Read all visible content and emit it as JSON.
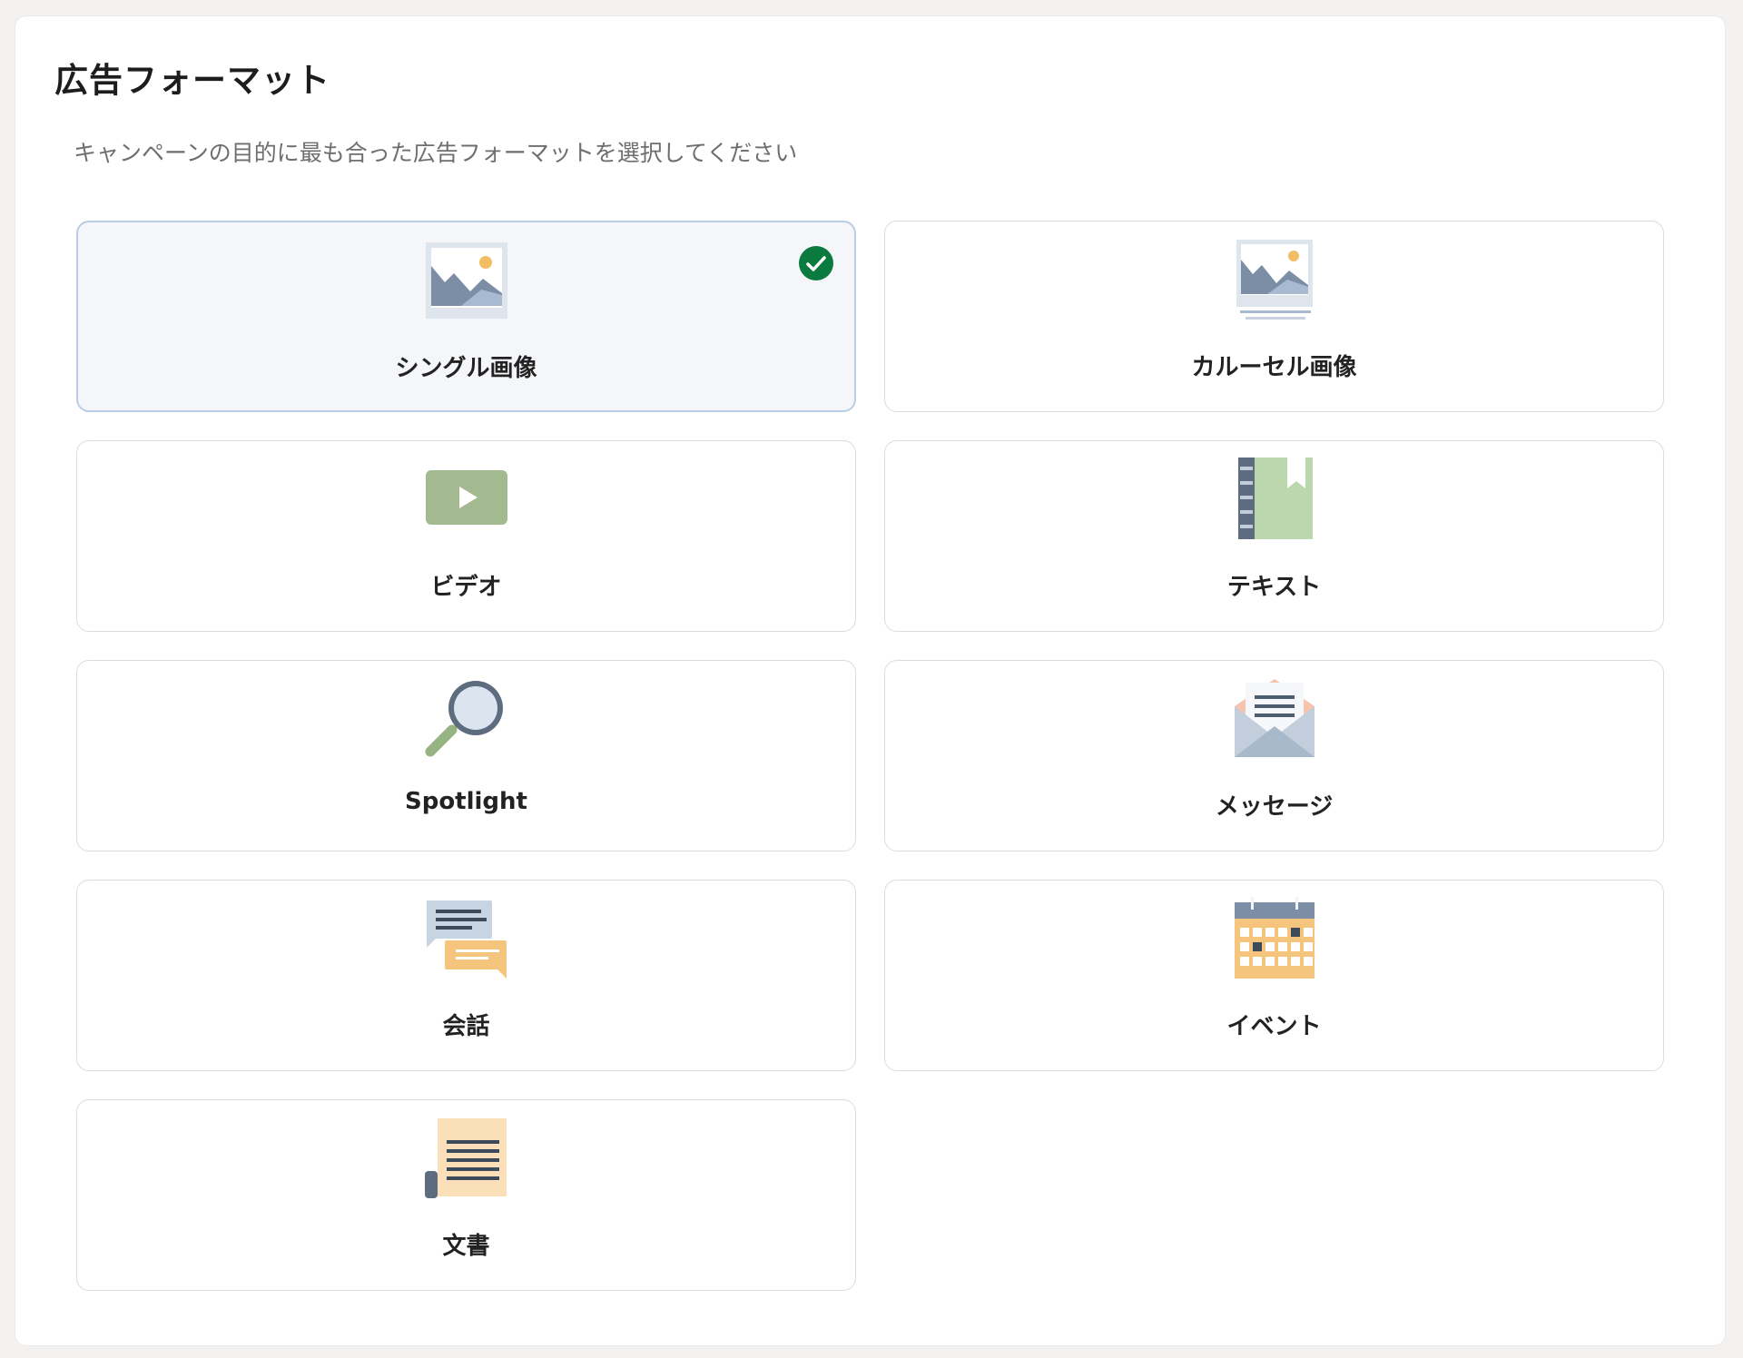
{
  "title": "広告フォーマット",
  "subtitle": "キャンペーンの目的に最も合った広告フォーマットを選択してください",
  "colors": {
    "selected_border": "#b9cde6",
    "selected_background": "#f4f6f9",
    "check_green": "#0a7a3e"
  },
  "formats": [
    {
      "label": "シングル画像",
      "icon": "single-image-icon",
      "selected": true
    },
    {
      "label": "カルーセル画像",
      "icon": "carousel-image-icon",
      "selected": false
    },
    {
      "label": "ビデオ",
      "icon": "video-icon",
      "selected": false
    },
    {
      "label": "テキスト",
      "icon": "text-notebook-icon",
      "selected": false
    },
    {
      "label": "Spotlight",
      "icon": "magnifier-icon",
      "selected": false
    },
    {
      "label": "メッセージ",
      "icon": "envelope-icon",
      "selected": false
    },
    {
      "label": "会話",
      "icon": "chat-bubbles-icon",
      "selected": false
    },
    {
      "label": "イベント",
      "icon": "calendar-icon",
      "selected": false
    },
    {
      "label": "文書",
      "icon": "document-icon",
      "selected": false
    }
  ]
}
